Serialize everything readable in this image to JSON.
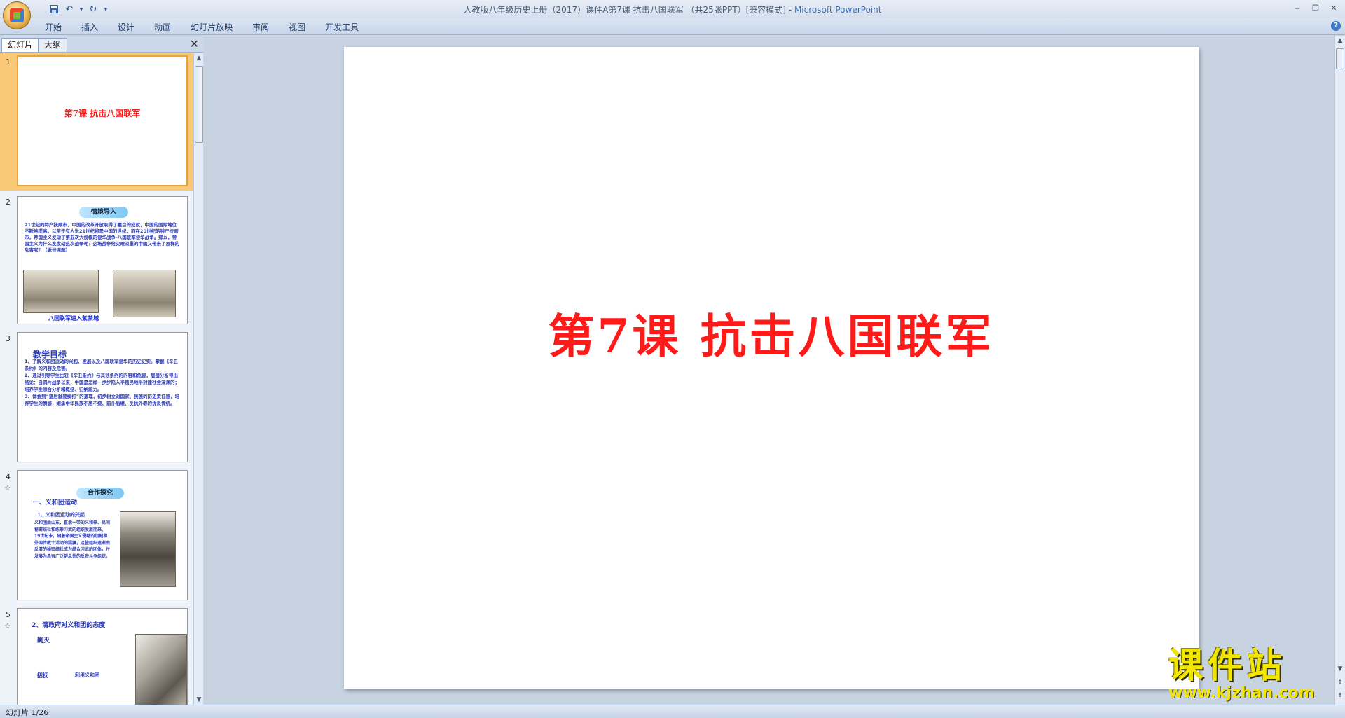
{
  "window": {
    "title_doc": "人教版八年级历史上册（2017）课件A第7课 抗击八国联军 （共25张PPT）[兼容模式] - ",
    "title_app": "Microsoft PowerPoint",
    "controls": [
      "‒",
      "❐",
      "✕"
    ]
  },
  "ribbon": {
    "tabs": [
      "开始",
      "插入",
      "设计",
      "动画",
      "幻灯片放映",
      "审阅",
      "视图",
      "开发工具"
    ],
    "help": "?"
  },
  "pane": {
    "tabs": [
      "幻灯片",
      "大纲"
    ],
    "close": "✕"
  },
  "slides": [
    {
      "num": "1",
      "title": "第7课  抗击八国联军"
    },
    {
      "num": "2",
      "badge": "情境导入",
      "body": "21世纪的特产抚顺市，中国的改革开放取得了瞩目的成就，中国的国际地位不断地提高。以至于有人说21世纪将是中国的世纪；而在20世纪的特产抚顺市，帝国主义发动了第五次大规模的侵华战争-八国联军侵华战争。那么，帝国主义为什么发发动这次战争呢？这场战争给灾难深重的中国又带来了怎样的危害呢？（板书课题）",
      "caption": "八国联军进入紫禁城"
    },
    {
      "num": "3",
      "heading": "教学目标",
      "body": "1、了解义和团运动的兴起、发展以及八国联军侵华的历史史实。掌握《辛丑条约》的内容及危害。\n2、通过引导学生比较《辛丑条约》与其他条约的内容和危害，层层分析得出结论：自鸦片战争以来，中国是怎样一步步陷入半殖民地半封建社会深渊的；培养学生综合分析和概括、归纳能力。\n3、体会到“落后就要挨打”的道理，初步树立对国家、民族的历史责任感，培养学生的情感，继承中华民族不屈不挠、前仆后继、反抗外辱的优良传统。"
    },
    {
      "num": "4",
      "star": "☆",
      "badge": "合作探究",
      "heading": "一、义和团运动",
      "sub": "1、义和团运动的兴起",
      "body": "义和团由山东、直隶一带的义和拳、民间秘密结社和练拳习武的组织发展而来。19世纪末，随着帝国主义侵略的加剧和外国传教士活动的猖獗，这些组织逐渐由反清的秘密结社成为结合习武的团体，并发展为具有广泛群众性的反帝斗争组织。"
    },
    {
      "num": "5",
      "star": "☆",
      "heading": "2、清政府对义和团的态度",
      "items": [
        "剿灭",
        "招抚",
        "利用义和团"
      ]
    }
  ],
  "main_slide": {
    "title": "第7课  抗击八国联军"
  },
  "watermark": {
    "big": "课件站",
    "url": "www.kjzhan.com"
  },
  "status": {
    "slide_counter": "幻灯片 1/26"
  }
}
